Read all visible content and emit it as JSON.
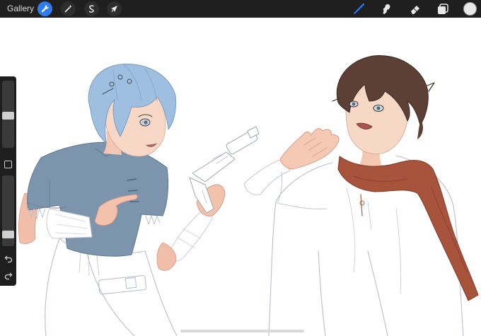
{
  "topbar": {
    "gallery_label": "Gallery",
    "left_tools": [
      {
        "name": "actions",
        "icon": "wrench-icon",
        "active": true
      },
      {
        "name": "adjustments",
        "icon": "magic-wand-icon",
        "active": false
      },
      {
        "name": "selection",
        "icon": "selection-s-icon",
        "active": false
      },
      {
        "name": "transform",
        "icon": "arrow-cursor-icon",
        "active": false
      }
    ],
    "right_tools": [
      {
        "name": "brush",
        "icon": "brush-icon",
        "active": true
      },
      {
        "name": "smudge",
        "icon": "smudge-icon",
        "active": false
      },
      {
        "name": "eraser",
        "icon": "eraser-icon",
        "active": false
      },
      {
        "name": "layers",
        "icon": "layers-icon",
        "active": false
      }
    ],
    "current_color": "#e8e8e8"
  },
  "sidebar": {
    "brush_size_level": 0.48,
    "opacity_level": 0.12,
    "buttons": [
      "modifier-square-icon",
      "undo-icon",
      "redo-icon"
    ]
  },
  "colors": {
    "accent": "#2f7bf0",
    "toolbar_bg": "#1f1f1f",
    "canvas_bg": "#ffffff"
  }
}
